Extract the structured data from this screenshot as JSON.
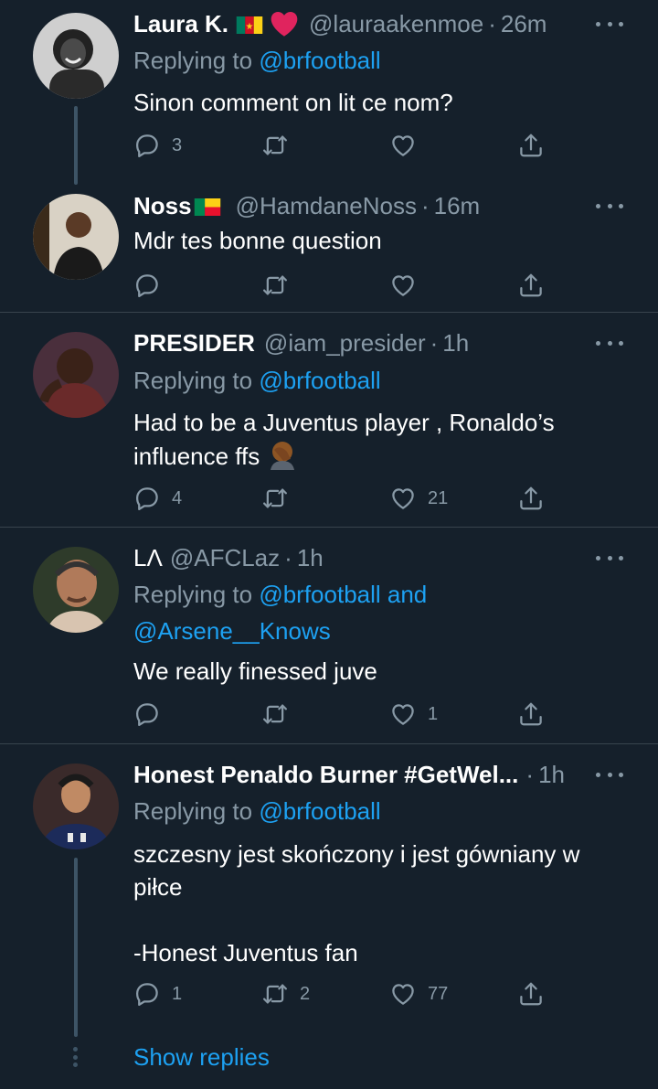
{
  "colors": {
    "background": "#15202b",
    "text": "#ffffff",
    "muted": "#8899a6",
    "link": "#1da1f2",
    "divider": "#38444d"
  },
  "icons": {
    "reply": "reply-icon",
    "retweet": "retweet-icon",
    "like": "heart-icon",
    "share": "share-icon",
    "more": "more-options-icon"
  },
  "tweets": [
    {
      "name": "Laura K.",
      "emoji": [
        "cameroon-flag-emoji",
        "red-heart-emoji"
      ],
      "handle": "@lauraakenmoe",
      "sep": "·",
      "time": "26m",
      "replying_prefix": "Replying to ",
      "replying_to": "@brfootball",
      "text": "Sinon comment on lit ce nom?",
      "counts": {
        "replies": "3",
        "retweets": "",
        "likes": ""
      }
    },
    {
      "name": "Noss",
      "emoji": [
        "benin-flag-emoji"
      ],
      "handle": "@HamdaneNoss",
      "sep": "·",
      "time": "16m",
      "text": "Mdr tes bonne question",
      "counts": {
        "replies": "",
        "retweets": "",
        "likes": ""
      }
    },
    {
      "name": "PRESIDER",
      "handle": "@iam_presider",
      "sep": "·",
      "time": "1h",
      "replying_prefix": "Replying to ",
      "replying_to": "@brfootball",
      "text_line1": "Had to be a Juventus player , Ronaldo’s",
      "text_line2": "influence ffs",
      "emoji": [
        "facepalm-emoji"
      ],
      "counts": {
        "replies": "4",
        "retweets": "",
        "likes": "21"
      }
    },
    {
      "name": "LΛ",
      "handle": "@AFCLaz",
      "sep": "·",
      "time": "1h",
      "replying_prefix": "Replying to ",
      "replying_to": "@brfootball and",
      "replying_to_2": "@Arsene__Knows",
      "text": "We really finessed juve",
      "counts": {
        "replies": "",
        "retweets": "",
        "likes": "1"
      }
    },
    {
      "name": "Honest Penaldo Burner #GetWel...",
      "handle": "",
      "sep": "·",
      "time": "1h",
      "replying_prefix": "Replying to ",
      "replying_to": "@brfootball",
      "text_line1": "szczesny jest skończony i jest gówniany w",
      "text_line2": "piłce",
      "text_line3": "-Honest Juventus fan",
      "counts": {
        "replies": "1",
        "retweets": "2",
        "likes": "77"
      }
    }
  ],
  "show_replies": "Show replies"
}
